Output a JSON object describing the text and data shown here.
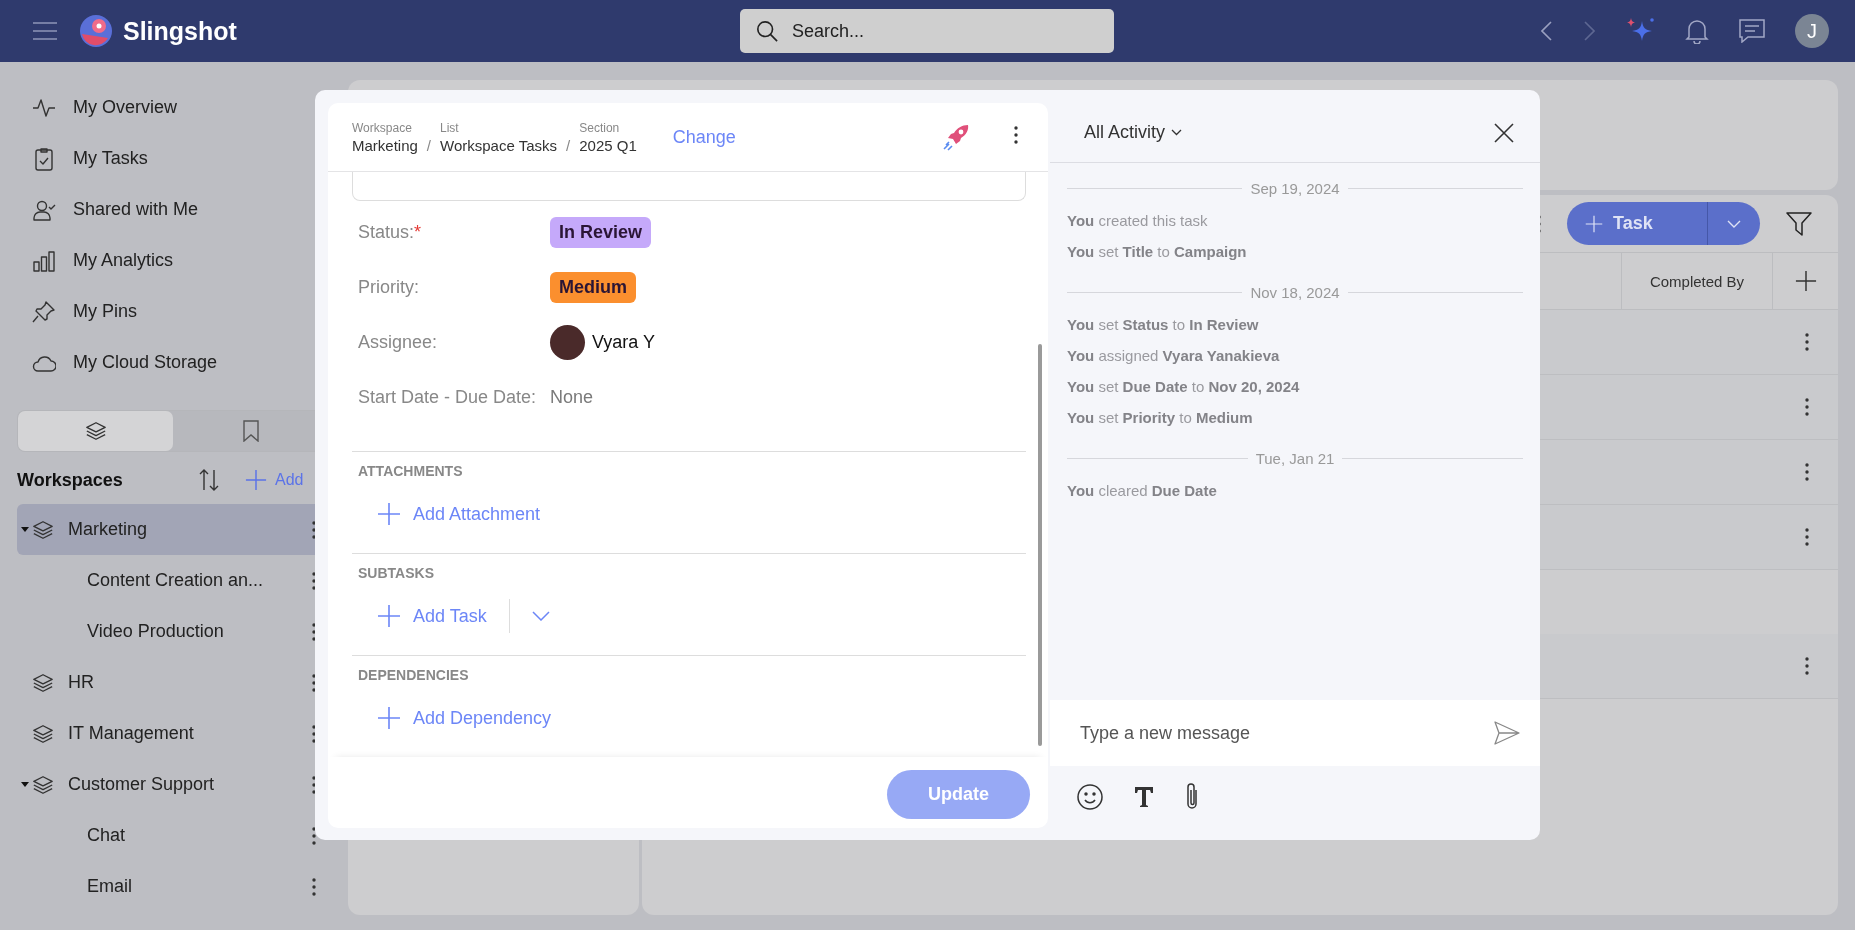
{
  "top_bar": {
    "app_name": "Slingshot",
    "search": {
      "placeholder": "Search..."
    },
    "user_initial": "J"
  },
  "sidebar": {
    "nav": [
      {
        "label": "My Overview"
      },
      {
        "label": "My Tasks"
      },
      {
        "label": "Shared with Me"
      },
      {
        "label": "My Analytics"
      },
      {
        "label": "My Pins"
      },
      {
        "label": "My Cloud Storage"
      }
    ],
    "view_tabs": [
      {
        "kind": "workspaces",
        "selected": true
      },
      {
        "kind": "bookmarks",
        "selected": false
      }
    ],
    "workspaces_title": "Workspaces",
    "add_label": "Add",
    "tree": [
      {
        "label": "Marketing",
        "selected": true,
        "expanded": true,
        "children": [
          {
            "label": "Content Creation an...",
            "selected": false
          },
          {
            "label": "Video Production",
            "selected": false
          }
        ]
      },
      {
        "label": "HR",
        "selected": false,
        "expanded": false
      },
      {
        "label": "IT Management",
        "selected": false,
        "expanded": false
      },
      {
        "label": "Customer Support",
        "selected": false,
        "expanded": true,
        "children": [
          {
            "label": "Chat",
            "selected": false
          },
          {
            "label": "Email",
            "selected": false
          }
        ]
      }
    ]
  },
  "list_view": {
    "task_button": "Task",
    "columns": [
      "Completed By"
    ],
    "rows": [
      {
        "menu": true
      },
      {
        "menu": true
      },
      {
        "menu": true
      },
      {
        "menu": true
      },
      {
        "menu": false
      },
      {
        "menu": true
      }
    ]
  },
  "task": {
    "breadcrumb": [
      {
        "label": "Workspace",
        "value": "Marketing",
        "separator": "/"
      },
      {
        "label": "List",
        "value": "Workspace Tasks",
        "separator": "/"
      },
      {
        "label": "Section",
        "value": "2025 Q1"
      }
    ],
    "change_link": "Change",
    "fields": [
      {
        "kind": "tag",
        "label": "Status:",
        "required_mark": "*",
        "value": "In Review",
        "color": "#c5a9fa"
      },
      {
        "kind": "tag",
        "label": "Priority:",
        "value": "Medium",
        "color": "#fb8f2e"
      },
      {
        "kind": "person",
        "label": "Assignee:",
        "value": "Vyara Y"
      },
      {
        "kind": "text",
        "label": "Start Date - Due Date:",
        "value": "None"
      }
    ],
    "sections": [
      {
        "title": "ATTACHMENTS",
        "action": "Add Attachment",
        "dropdown": false
      },
      {
        "title": "SUBTASKS",
        "action": "Add Task",
        "dropdown": true
      },
      {
        "title": "DEPENDENCIES",
        "action": "Add Dependency",
        "dropdown": false
      }
    ],
    "update_button": {
      "label": "Update",
      "disabled": true
    }
  },
  "activity": {
    "filter": "All Activity",
    "groups": [
      {
        "date": "Sep 19, 2024",
        "entries": [
          "**You** created this task",
          "**You** set **Title** to **Campaign**"
        ]
      },
      {
        "date": "Nov 18, 2024",
        "entries": [
          "**You** set **Status** to **In Review**",
          "**You** assigned **Vyara Yanakieva**",
          "**You** set **Due Date** to **Nov 20, 2024**",
          "**You** set **Priority** to **Medium**"
        ]
      },
      {
        "date": "Tue, Jan 21",
        "entries": [
          "**You** cleared **Due Date**"
        ]
      }
    ],
    "message": {
      "placeholder": "Type a new message"
    }
  }
}
